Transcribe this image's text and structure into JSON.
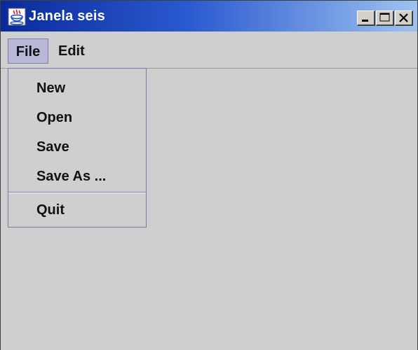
{
  "window": {
    "title": "Janela seis",
    "controls": {
      "minimize_icon": "minimize-icon",
      "maximize_icon": "maximize-icon",
      "close_icon": "close-icon"
    }
  },
  "menubar": {
    "file_label": "File",
    "edit_label": "Edit"
  },
  "file_menu": {
    "items": [
      {
        "label": "New"
      },
      {
        "label": "Open"
      },
      {
        "label": "Save"
      },
      {
        "label": "Save As ..."
      },
      {
        "label": "Quit"
      }
    ]
  },
  "colors": {
    "titlebar_start": "#0a2a9a",
    "titlebar_end": "#9ec3f0",
    "background": "#cfcfcf",
    "menu_highlight": "#b8b8d8",
    "menu_border": "#7a7aa8"
  }
}
